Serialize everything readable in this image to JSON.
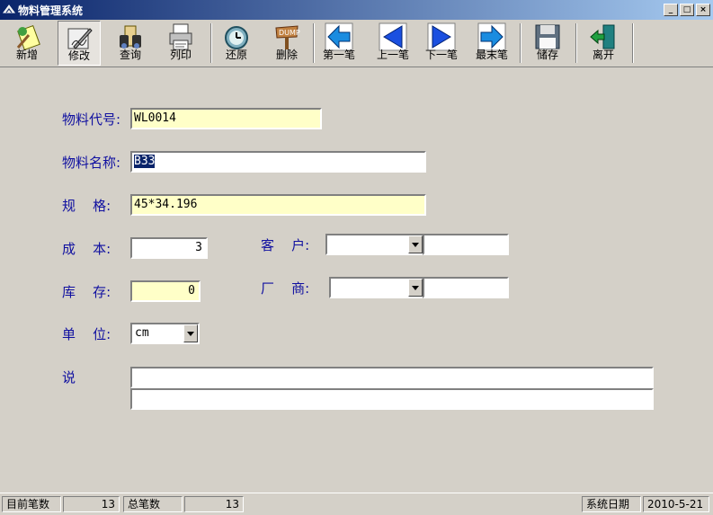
{
  "window": {
    "title": "物料管理系统",
    "controls": [
      "_",
      "□",
      "×"
    ]
  },
  "toolbar": {
    "buttons": [
      {
        "label": "新增",
        "icon": "new-icon"
      },
      {
        "label": "修改",
        "icon": "edit-icon"
      },
      {
        "label": "查询",
        "icon": "binoculars-icon"
      },
      {
        "label": "列印",
        "icon": "print-icon"
      },
      {
        "label": "还原",
        "icon": "clock-icon"
      },
      {
        "label": "删除",
        "icon": "dump-icon"
      },
      {
        "label": "第一笔",
        "icon": "first-arrow-icon"
      },
      {
        "label": "上一笔",
        "icon": "prev-arrow-icon"
      },
      {
        "label": "下一笔",
        "icon": "next-arrow-icon"
      },
      {
        "label": "最末笔",
        "icon": "last-arrow-icon"
      },
      {
        "label": "储存",
        "icon": "floppy-disk-icon"
      },
      {
        "label": "离开",
        "icon": "exit-door-icon"
      }
    ]
  },
  "form": {
    "code": {
      "label": "物料代号:",
      "value": "WL0014"
    },
    "name": {
      "label": "物料名称:",
      "value": "B33"
    },
    "spec": {
      "label": "规    格:",
      "value": "45*34.196"
    },
    "cost": {
      "label": "成    本:",
      "value": "3"
    },
    "customer": {
      "label": "客    户:",
      "value": "",
      "text": ""
    },
    "stock": {
      "label": "库    存:",
      "value": "0"
    },
    "vendor": {
      "label": "厂    商:",
      "value": "",
      "text": ""
    },
    "unit": {
      "label": "单    位:",
      "value": "cm"
    },
    "note": {
      "label": "说",
      "line1": "",
      "line2": ""
    }
  },
  "status": {
    "current_label": "目前笔数",
    "current_value": "13",
    "total_label": "总笔数",
    "total_value": "13",
    "date_label": "系统日期",
    "date_value": "2010-5-21"
  },
  "colors": {
    "label_text": "#1010a0",
    "required_field": "#ffffc8",
    "title_bar": "#0a246a"
  }
}
